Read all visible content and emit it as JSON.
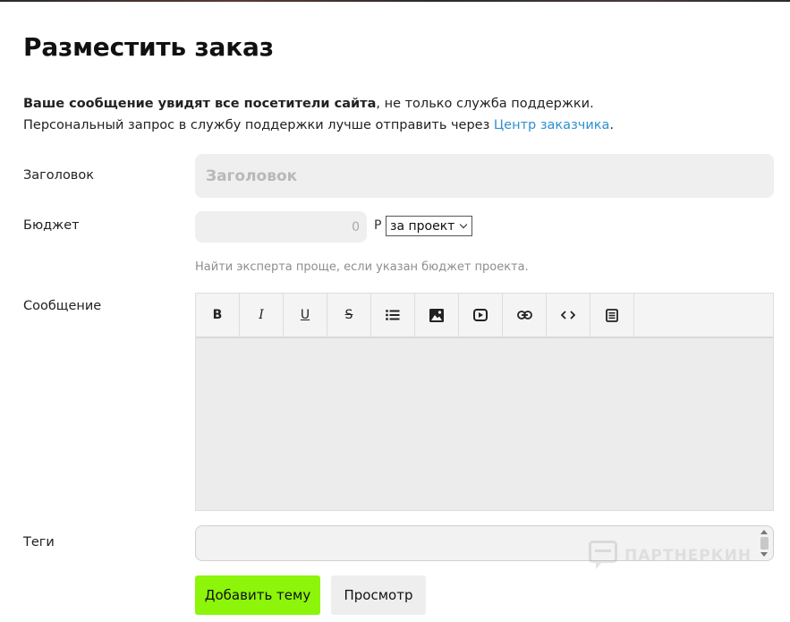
{
  "page": {
    "title": "Разместить заказ"
  },
  "notice": {
    "bold_text": "Ваше сообщение увидят все посетители сайта",
    "rest_line1": ", не только служба поддержки.",
    "line2_prefix": "Персональный запрос в службу поддержки лучше отправить через ",
    "link_text": "Центр заказчика",
    "line2_suffix": "."
  },
  "form": {
    "title_label": "Заголовок",
    "title_placeholder": "Заголовок",
    "budget_label": "Бюджет",
    "budget_placeholder": "0",
    "currency_symbol": "Р",
    "budget_period_selected": "за проект",
    "budget_hint": "Найти эксперта проще, если указан бюджет проекта.",
    "message_label": "Сообщение",
    "tags_label": "Теги",
    "submit_label": "Добавить тему",
    "preview_label": "Просмотр"
  },
  "toolbar": {
    "buttons": [
      {
        "name": "bold-button",
        "glyph": "B"
      },
      {
        "name": "italic-button",
        "glyph": "I"
      },
      {
        "name": "underline-button",
        "glyph": "U"
      },
      {
        "name": "strikethrough-button",
        "glyph": "S"
      },
      {
        "name": "list-button",
        "icon": "list-icon"
      },
      {
        "name": "image-button",
        "icon": "image-icon"
      },
      {
        "name": "video-button",
        "icon": "video-icon"
      },
      {
        "name": "link-button",
        "icon": "link-icon"
      },
      {
        "name": "code-button",
        "icon": "code-icon"
      },
      {
        "name": "quote-button",
        "icon": "document-icon"
      }
    ]
  },
  "watermark": {
    "text": "ПАРТНЕРКИН"
  },
  "colors": {
    "accent_green": "#8cf50a",
    "link_blue": "#2f8fd0",
    "field_bg": "#efefef",
    "hint_gray": "#8e8e8e"
  }
}
